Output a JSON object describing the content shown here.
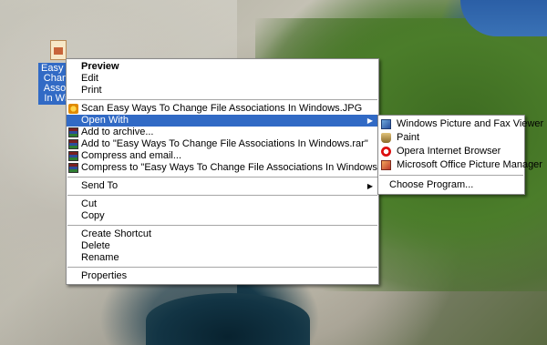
{
  "desktop_icon": {
    "label_lines": [
      "Easy W",
      "Chang",
      "Associ",
      "In Win"
    ]
  },
  "context_menu": {
    "groups": [
      [
        {
          "label": "Preview",
          "bold": true
        },
        {
          "label": "Edit"
        },
        {
          "label": "Print"
        }
      ],
      [
        {
          "label": "Scan Easy Ways To Change File Associations In Windows.JPG",
          "icon": "scan-icon"
        },
        {
          "label": "Open With",
          "submenu": true,
          "highlighted": true
        },
        {
          "label": "Add to archive...",
          "icon": "rar-icon"
        },
        {
          "label": "Add to \"Easy Ways To Change File Associations In Windows.rar\"",
          "icon": "rar-icon"
        },
        {
          "label": "Compress and email...",
          "icon": "rar-icon"
        },
        {
          "label": "Compress to \"Easy Ways To Change File Associations In Windows.rar\" and email",
          "icon": "rar-icon"
        }
      ],
      [
        {
          "label": "Send To",
          "submenu": true
        }
      ],
      [
        {
          "label": "Cut"
        },
        {
          "label": "Copy"
        }
      ],
      [
        {
          "label": "Create Shortcut"
        },
        {
          "label": "Delete"
        },
        {
          "label": "Rename"
        }
      ],
      [
        {
          "label": "Properties"
        }
      ]
    ]
  },
  "open_with_submenu": {
    "apps": [
      {
        "label": "Windows Picture and Fax Viewer",
        "icon": "picture-viewer-icon"
      },
      {
        "label": "Paint",
        "icon": "paint-icon"
      },
      {
        "label": "Opera Internet Browser",
        "icon": "opera-icon"
      },
      {
        "label": "Microsoft Office Picture Manager",
        "icon": "picture-manager-icon"
      }
    ],
    "choose_program": "Choose Program..."
  },
  "arrow_glyph": "▶"
}
